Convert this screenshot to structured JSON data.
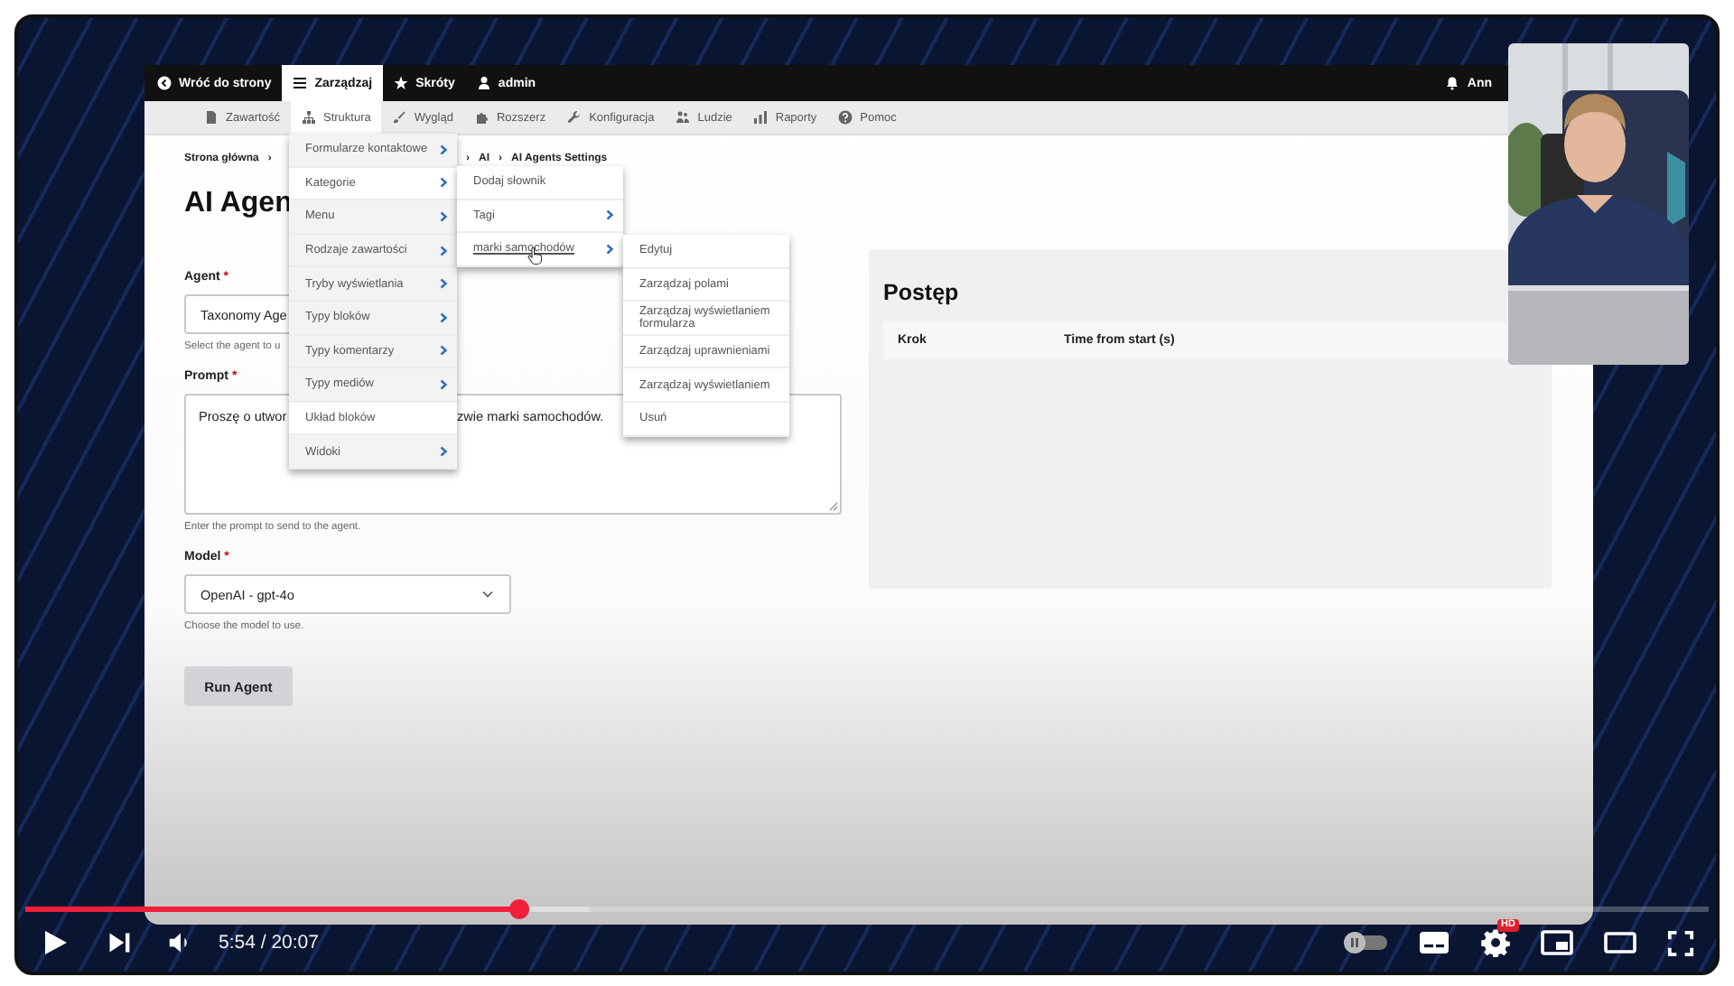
{
  "toolbar": {
    "items": [
      {
        "kind": "back",
        "label": "Wróć do strony",
        "selected": false
      },
      {
        "kind": "menu",
        "label": "Zarządzaj",
        "selected": true
      },
      {
        "kind": "star",
        "label": "Skróty",
        "selected": false
      },
      {
        "kind": "user",
        "label": "admin",
        "selected": false
      }
    ],
    "user_menu": {
      "kind": "bell",
      "label": "Ann"
    }
  },
  "tray": {
    "items": [
      {
        "kind": "page",
        "label": "Zawartość",
        "selected": false
      },
      {
        "kind": "sitemap",
        "label": "Struktura",
        "selected": true
      },
      {
        "kind": "brush",
        "label": "Wygląd",
        "selected": false
      },
      {
        "kind": "puzzle",
        "label": "Rozszerz",
        "selected": false
      },
      {
        "kind": "wrench",
        "label": "Konfiguracja",
        "selected": false
      },
      {
        "kind": "people",
        "label": "Ludzie",
        "selected": false
      },
      {
        "kind": "bars",
        "label": "Raporty",
        "selected": false
      },
      {
        "kind": "question",
        "label": "Pomoc",
        "selected": false
      }
    ]
  },
  "breadcrumb": {
    "separator": "›",
    "before_menu": [
      "Strona główna"
    ],
    "after_menu": [
      "AI",
      "AI Agents Settings"
    ]
  },
  "page_title": "AI Agen",
  "form": {
    "required_mark": "*",
    "fields": [
      {
        "kind": "select",
        "label": "Agent",
        "required": true,
        "value": "Taxonomy Age",
        "chevron": false,
        "help": "Select the agent to u"
      },
      {
        "kind": "textarea",
        "label": "Prompt",
        "required": true,
        "value_parts": [
          "Proszę o utwor",
          "zwie marki samochodów."
        ],
        "help": "Enter the prompt to send to the agent."
      },
      {
        "kind": "select",
        "label": "Model",
        "required": true,
        "value": "OpenAI - gpt-4o",
        "chevron": true,
        "help": "Choose the model to use."
      }
    ],
    "submit": "Run Agent"
  },
  "progress_panel": {
    "title": "Postęp",
    "columns": [
      "Krok",
      "Time from start (s)"
    ]
  },
  "menus": [
    {
      "items": [
        {
          "label": "Formularze kontaktowe",
          "has_submenu": true,
          "expanded": false
        },
        {
          "label": "Kategorie",
          "has_submenu": true,
          "expanded": true
        },
        {
          "label": "Menu",
          "has_submenu": true,
          "expanded": false
        },
        {
          "label": "Rodzaje zawartości",
          "has_submenu": true,
          "expanded": false
        },
        {
          "label": "Tryby wyświetlania",
          "has_submenu": true,
          "expanded": false
        },
        {
          "label": "Typy bloków",
          "has_submenu": true,
          "expanded": false
        },
        {
          "label": "Typy komentarzy",
          "has_submenu": true,
          "expanded": false
        },
        {
          "label": "Typy mediów",
          "has_submenu": true,
          "expanded": false
        },
        {
          "label": "Układ bloków",
          "has_submenu": false,
          "expanded": false
        },
        {
          "label": "Widoki",
          "has_submenu": true,
          "expanded": false
        }
      ]
    },
    {
      "items": [
        {
          "label": "Dodaj słownik",
          "has_submenu": false,
          "expanded": false
        },
        {
          "label": "Tagi",
          "has_submenu": true,
          "expanded": false
        },
        {
          "label": "marki samochodów",
          "has_submenu": true,
          "expanded": true
        }
      ]
    },
    {
      "items": [
        {
          "label": "Edytuj",
          "has_submenu": false,
          "expanded": false
        },
        {
          "label": "Zarządzaj polami",
          "has_submenu": false,
          "expanded": false
        },
        {
          "label": "Zarządzaj wyświetlaniem formularza",
          "has_submenu": false,
          "expanded": false
        },
        {
          "label": "Zarządzaj uprawnieniami",
          "has_submenu": false,
          "expanded": false
        },
        {
          "label": "Zarządzaj wyświetlaniem",
          "has_submenu": false,
          "expanded": false
        },
        {
          "label": "Usuń",
          "has_submenu": false,
          "expanded": false
        }
      ]
    }
  ],
  "player": {
    "progress": {
      "level": 0.293
    },
    "buffered": {
      "level": 0.335
    },
    "time": "5:54 / 20:07",
    "autoplay": {
      "on": false
    },
    "quality_badge": "HD"
  }
}
